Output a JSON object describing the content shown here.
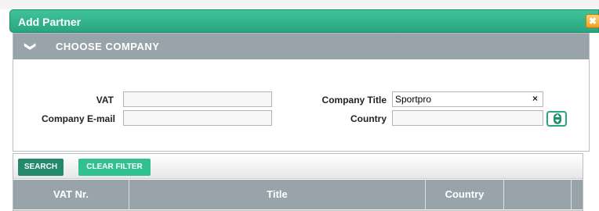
{
  "dialog": {
    "title": "Add Partner",
    "close_glyph": "✖"
  },
  "panel": {
    "chevron": "❯",
    "title": "CHOOSE COMPANY"
  },
  "form": {
    "vat_label": "VAT",
    "vat_value": "",
    "email_label": "Company E-mail",
    "email_value": "",
    "company_title_label": "Company Title",
    "company_title_value": "Sportpro",
    "clear_glyph": "×",
    "country_label": "Country",
    "country_value": ""
  },
  "toolbar": {
    "search_label": "SEARCH",
    "clear_filter_label": "CLEAR FILTER"
  },
  "table": {
    "columns": [
      "VAT Nr.",
      "Title",
      "Country",
      ""
    ]
  },
  "colors": {
    "accent": "#28a57f",
    "header_gray": "#98a4aa"
  }
}
